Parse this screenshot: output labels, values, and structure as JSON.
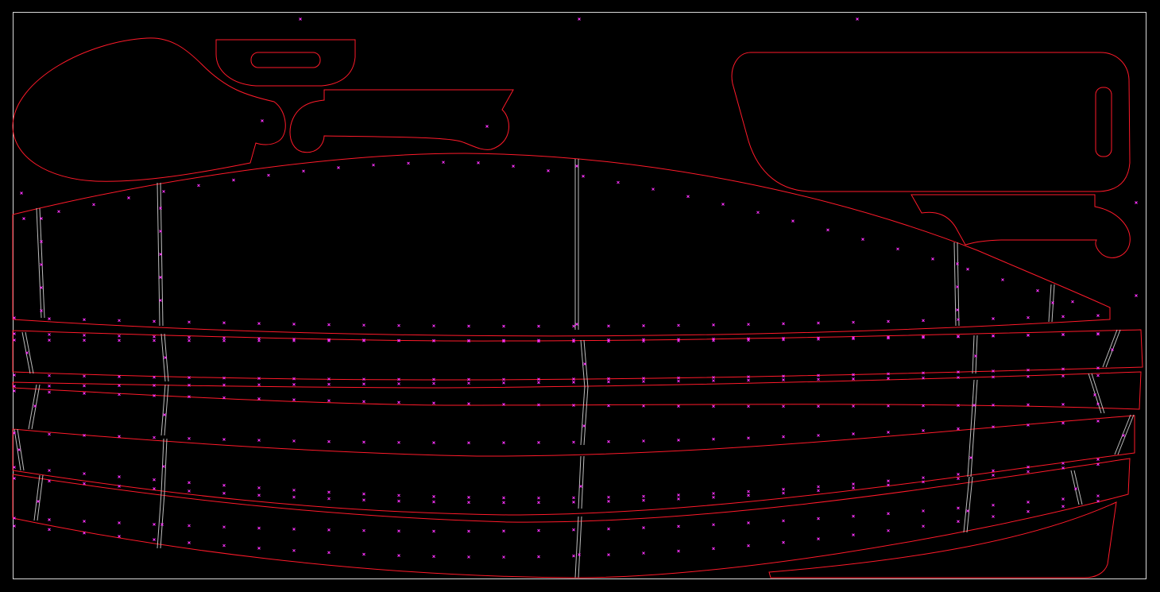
{
  "drawing": {
    "background": "#000000",
    "sheet_outline_color": "#d9d9d9",
    "cut_line_color": "#ff1a2a",
    "stitch_mark_color": "#ff33ff",
    "seam_line_color": "#bdbdbd",
    "mark_glyph": "x-mark"
  }
}
